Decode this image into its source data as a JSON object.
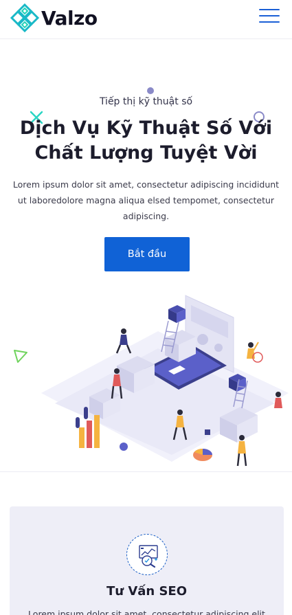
{
  "header": {
    "brand": "Valzo",
    "menu_icon": "hamburger-menu-icon",
    "accent_color": "#1a5fd6"
  },
  "hero": {
    "eyebrow": "Tiếp thị kỹ thuật số",
    "title": "Dịch Vụ Kỹ Thuật Số Với Chất Lượng Tuyệt Vời",
    "description": "Lorem ipsum dolor sit amet, consectetur adipiscing incididunt ut laboredolore magna aliqua elsed tempomet, consectetur adipiscing.",
    "cta_label": "Bắt đầu",
    "cta_color": "#1062d6",
    "illustration": "isometric-digital-office-illustration"
  },
  "services": [
    {
      "icon": "seo-analytics-icon",
      "title": "Tư Vấn SEO",
      "description": "Lorem ipsum dolor sit amet, consectetur adipiscing elit"
    }
  ]
}
